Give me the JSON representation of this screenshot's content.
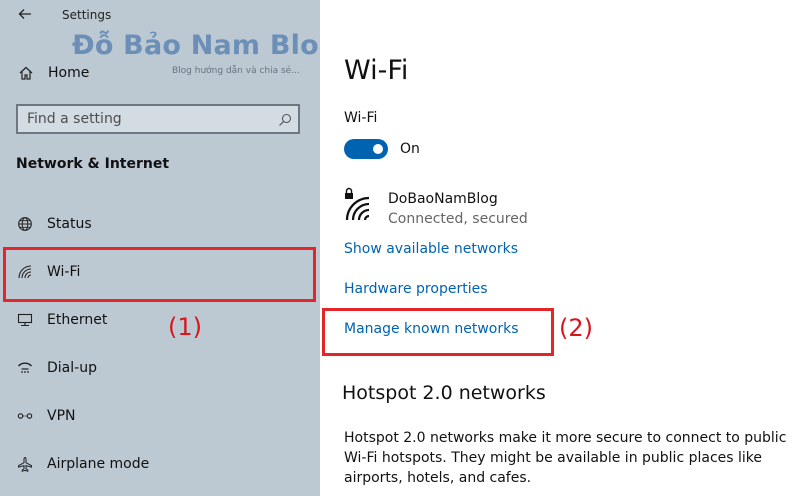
{
  "window": {
    "title": "Settings"
  },
  "watermark": {
    "title": "Đỗ Bảo Nam Blog",
    "subtitle": "Blog hướng dẫn và chia sẻ..."
  },
  "sidebar": {
    "home_label": "Home",
    "search_placeholder": "Find a setting",
    "section_title": "Network & Internet",
    "items": [
      {
        "label": "Status",
        "icon": "globe-icon"
      },
      {
        "label": "Wi-Fi",
        "icon": "wifi-icon"
      },
      {
        "label": "Ethernet",
        "icon": "ethernet-icon"
      },
      {
        "label": "Dial-up",
        "icon": "dialup-icon"
      },
      {
        "label": "VPN",
        "icon": "vpn-icon"
      },
      {
        "label": "Airplane mode",
        "icon": "airplane-icon"
      }
    ]
  },
  "annotations": {
    "label1": "(1)",
    "label2": "(2)",
    "box_color": "#e3262a"
  },
  "main": {
    "title": "Wi-Fi",
    "wifi_label": "Wi-Fi",
    "toggle_state": "On",
    "network": {
      "name": "DoBaoNamBlog",
      "status": "Connected, secured"
    },
    "links": {
      "show_available": "Show available networks",
      "hardware": "Hardware properties",
      "manage_known": "Manage known networks"
    },
    "hotspot": {
      "title": "Hotspot 2.0 networks",
      "description": "Hotspot 2.0 networks make it more secure to connect to public Wi-Fi hotspots. They might be available in public places like airports, hotels, and cafes."
    }
  },
  "colors": {
    "accent": "#0063b1",
    "sidebar_bg": "#bcc8d2",
    "annotation_red": "#e3262a"
  }
}
